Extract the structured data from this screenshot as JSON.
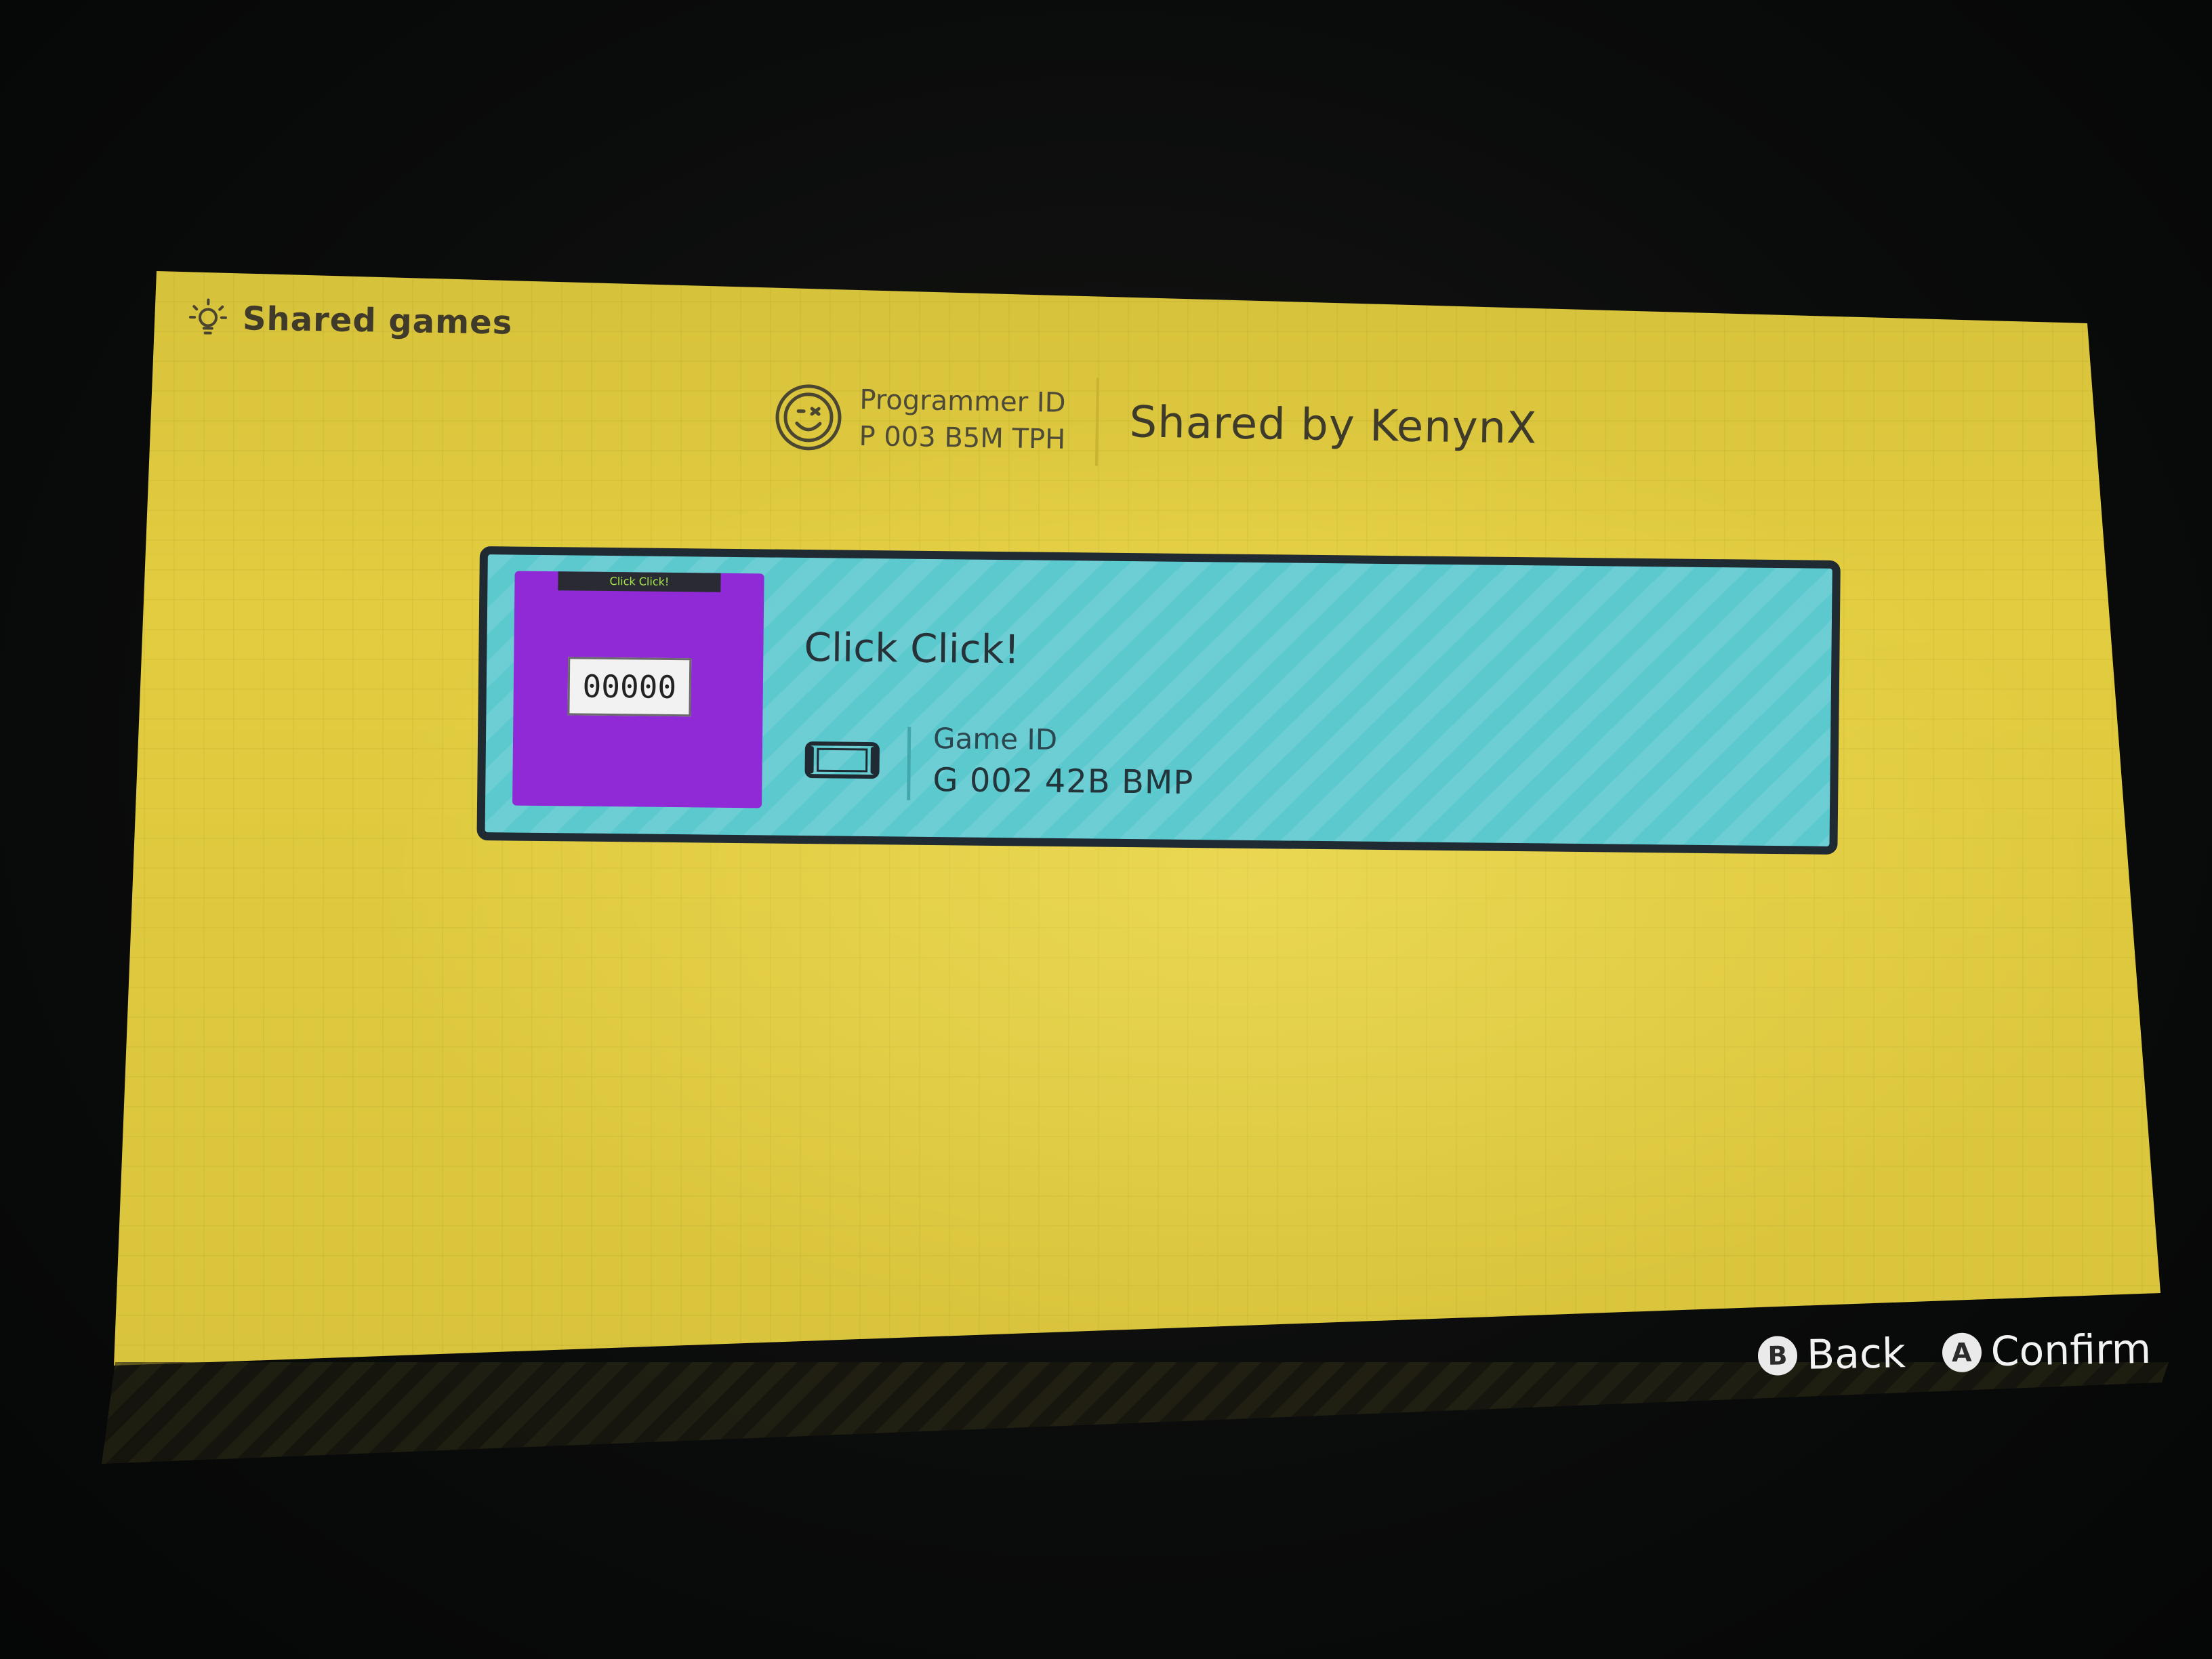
{
  "header": {
    "title": "Shared games",
    "icon": "lightbulb-icon"
  },
  "programmer": {
    "label": "Programmer ID",
    "id": "P 003 B5M TPH",
    "icon": "face-icon",
    "shared_by": "Shared by KenynX"
  },
  "game": {
    "thumbnail_title": "Click Click!",
    "thumbnail_counter": "00000",
    "title": "Click Click!",
    "device_icon": "handheld-console-icon",
    "id_label": "Game ID",
    "id": "G 002 42B BMP"
  },
  "footer": {
    "back_button": "B",
    "back_label": "Back",
    "confirm_button": "A",
    "confirm_label": "Confirm"
  },
  "colors": {
    "background": "#e2cc3f",
    "card": "#5cc9cf",
    "card_border": "#1f2a33",
    "thumbnail": "#8f2ad6"
  }
}
